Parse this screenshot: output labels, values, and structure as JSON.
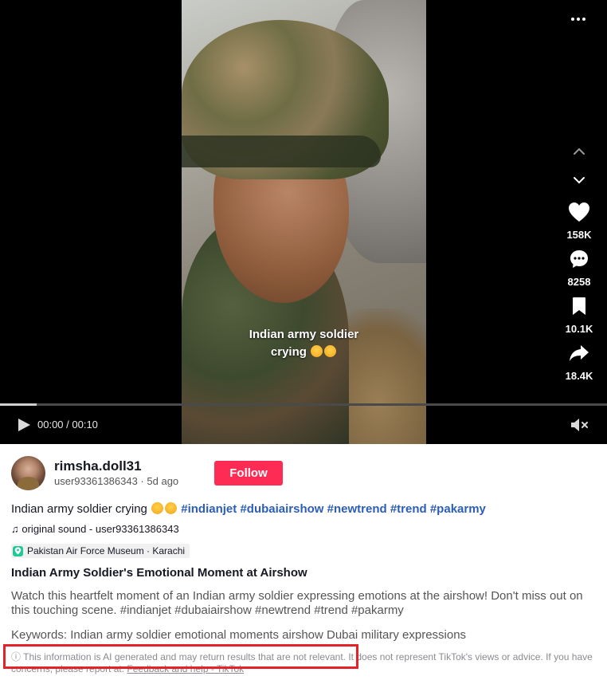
{
  "video": {
    "caption_line1": "Indian army soldier",
    "caption_line2": "crying",
    "time": "00:00 / 00:10",
    "progress": 0.06
  },
  "actions": {
    "likes": "158K",
    "comments": "8258",
    "saves": "10.1K",
    "shares": "18.4K"
  },
  "author": {
    "username": "rimsha.doll31",
    "handle": "user93361386343",
    "posted": "5d ago",
    "separator": " · ",
    "follow_label": "Follow"
  },
  "description": {
    "text": "Indian army soldier crying",
    "hashtags": [
      "#indianjet",
      "#dubaiairshow",
      "#newtrend",
      "#trend",
      "#pakarmy"
    ]
  },
  "sound": "original sound - user93361386343",
  "location": "Pakistan Air Force Museum · Karachi",
  "ai_summary": {
    "title": "Indian Army Soldier's Emotional Moment at Airshow",
    "body": "Watch this heartfelt moment of an Indian army soldier expressing emotions at the airshow! Don't miss out on this touching scene. #indianjet #dubaiairshow #newtrend #trend #pakarmy",
    "keywords": "Keywords: Indian army soldier emotional moments airshow Dubai military expressions",
    "disclaimer": "This information is AI generated and may return results that are not relevant. It does not represent TikTok's views or advice. If you have concerns, please report at:",
    "report_link": "Feedback and help - TikTok"
  },
  "colors": {
    "follow": "#fe2c55",
    "hashtag": "#2b5db9",
    "highlight": "#e3222b"
  }
}
